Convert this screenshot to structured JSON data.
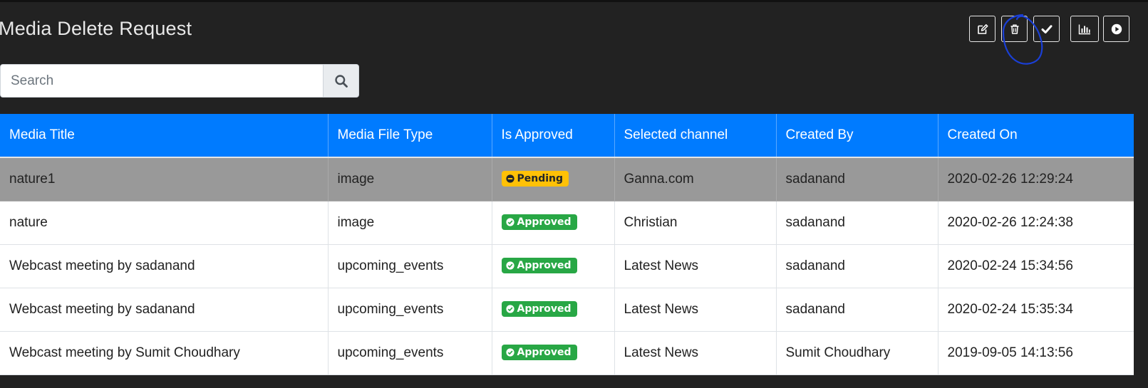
{
  "page": {
    "title": "Media Delete Request"
  },
  "toolbar": {
    "buttons": [
      {
        "name": "edit-button",
        "icon": "edit-icon"
      },
      {
        "name": "delete-button",
        "icon": "trash-icon"
      },
      {
        "name": "approve-button",
        "icon": "check-icon"
      },
      {
        "name": "stats-button",
        "icon": "bar-chart-icon"
      },
      {
        "name": "play-button",
        "icon": "play-circle-icon"
      }
    ]
  },
  "search": {
    "placeholder": "Search",
    "value": "",
    "icon": "search-icon"
  },
  "table": {
    "columns": [
      "Media Title",
      "Media File Type",
      "Is Approved",
      "Selected channel",
      "Created By",
      "Created On"
    ],
    "rows": [
      {
        "title": "nature1",
        "type": "image",
        "status": "Pending",
        "channel": "Ganna.com",
        "created_by": "sadanand",
        "created_on": "2020-02-26 12:29:24"
      },
      {
        "title": "nature",
        "type": "image",
        "status": "Approved",
        "channel": "Christian",
        "created_by": "sadanand",
        "created_on": "2020-02-26 12:24:38"
      },
      {
        "title": "Webcast meeting by sadanand",
        "type": "upcoming_events",
        "status": "Approved",
        "channel": "Latest News",
        "created_by": "sadanand",
        "created_on": "2020-02-24 15:34:56"
      },
      {
        "title": "Webcast meeting by sadanand",
        "type": "upcoming_events",
        "status": "Approved",
        "channel": "Latest News",
        "created_by": "sadanand",
        "created_on": "2020-02-24 15:35:34"
      },
      {
        "title": "Webcast meeting by Sumit Choudhary",
        "type": "upcoming_events",
        "status": "Approved",
        "channel": "Latest News",
        "created_by": "Sumit Choudhary",
        "created_on": "2019-09-05 14:13:56"
      }
    ]
  },
  "colors": {
    "background": "#222222",
    "header": "#007bff",
    "selected_row": "#999999",
    "pending": "#ffc107",
    "approved": "#28a745",
    "annotation": "#1a3fd6"
  }
}
